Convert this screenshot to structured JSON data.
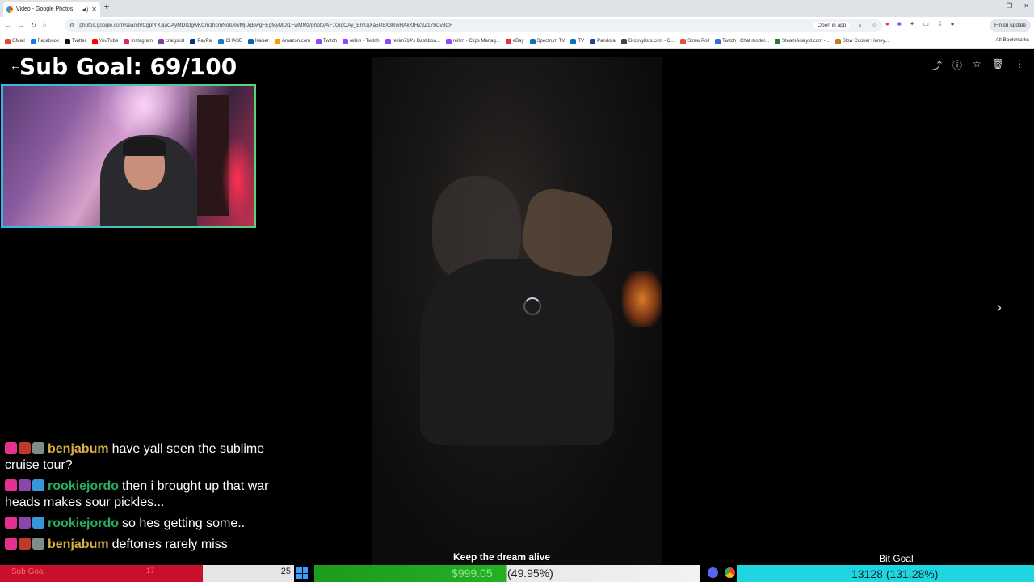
{
  "browser": {
    "tab_title": "Video - Google Photos",
    "url": "photos.google.com/search/CgptYXJjaCAyMDI1IgwKCm1hcmNoIDIwMjUqBwgFEgMyMDI1FwMMz/photo/AF1QipOAy_EmUjXa5U8X3RwHAkKtHZ8Z17bCv3CF",
    "open_in_app": "Open in app",
    "finish_update": "Finish update",
    "all_bookmarks": "All Bookmarks",
    "bookmarks": [
      {
        "label": "GMail",
        "color": "#ea4335"
      },
      {
        "label": "Facebook",
        "color": "#1877f2"
      },
      {
        "label": "Twitter",
        "color": "#111111"
      },
      {
        "label": "YouTube",
        "color": "#ff0000"
      },
      {
        "label": "Instagram",
        "color": "#d62976"
      },
      {
        "label": "craigslist",
        "color": "#7a3fa0"
      },
      {
        "label": "PayPal",
        "color": "#003087"
      },
      {
        "label": "CHASE",
        "color": "#117aca"
      },
      {
        "label": "Kaiser",
        "color": "#0066b3"
      },
      {
        "label": "Amazon.com",
        "color": "#ff9900"
      },
      {
        "label": "Twitch",
        "color": "#9146ff"
      },
      {
        "label": "rellim - Twitch",
        "color": "#9146ff"
      },
      {
        "label": "rellim714's Dashboa...",
        "color": "#9146ff"
      },
      {
        "label": "rellim - Clips Manag...",
        "color": "#9146ff"
      },
      {
        "label": "eBay",
        "color": "#e53238"
      },
      {
        "label": "Spectrum TV",
        "color": "#0077c8"
      },
      {
        "label": "TV",
        "color": "#0077c8"
      },
      {
        "label": "Pandora",
        "color": "#224099"
      },
      {
        "label": "Groovylists.com - C...",
        "color": "#444444"
      },
      {
        "label": "Straw Poll",
        "color": "#e84f3d"
      },
      {
        "label": "Twitch | Chat moder...",
        "color": "#2f6fd6"
      },
      {
        "label": "SteamAnalyst.com -...",
        "color": "#2a7a2a"
      },
      {
        "label": "Slow Cooker Honey...",
        "color": "#c07a20"
      }
    ]
  },
  "overlay": {
    "sub_goal": "Sub Goal: 69/100",
    "chat": [
      {
        "user": "benjabum",
        "user_color": "#d8b043",
        "text": "have yall seen the sublime cruise tour?",
        "badges": [
          "#e4308f",
          "#c0392b",
          "#7f8c8d"
        ]
      },
      {
        "user": "rookiejordo",
        "user_color": "#27ae60",
        "text": "then i brought up that war heads makes sour pickles...",
        "badges": [
          "#e4308f",
          "#8e44ad",
          "#3498db"
        ]
      },
      {
        "user": "rookiejordo",
        "user_color": "#27ae60",
        "text": "so hes getting some..",
        "badges": [
          "#e4308f",
          "#8e44ad",
          "#3498db"
        ]
      },
      {
        "user": "benjabum",
        "user_color": "#d8b043",
        "text": "deftones rarely miss",
        "badges": [
          "#e4308f",
          "#c0392b",
          "#7f8c8d"
        ]
      }
    ],
    "keep_dream": "Keep the dream alive",
    "bit_goal_label": "Bit Goal",
    "bars": {
      "sub_label": "Sub Goal",
      "sub_count": "17",
      "sub_value": "25",
      "money_value": "$999.05",
      "money_percent": "(49.95%)",
      "money_fraction": 0.4995,
      "bit_value": "13128 (131.28%)"
    }
  }
}
